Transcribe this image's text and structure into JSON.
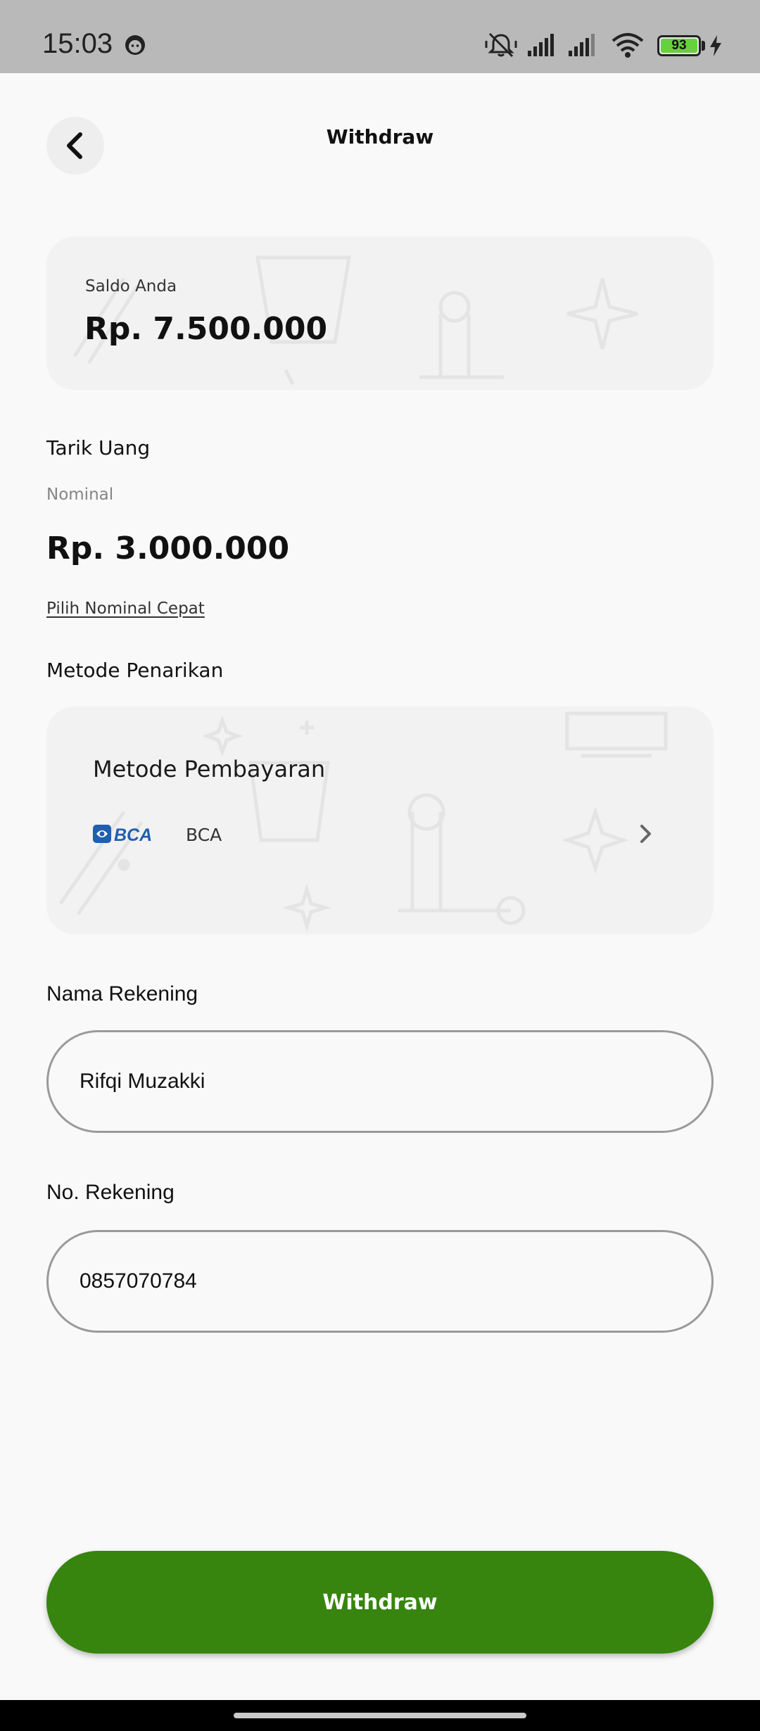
{
  "status_bar": {
    "time": "15:03",
    "battery": "93",
    "icons": [
      "face-notification-icon",
      "mute-icon",
      "signal-icon",
      "signal-icon",
      "wifi-icon",
      "battery-icon",
      "charging-icon"
    ]
  },
  "header": {
    "title": "Withdraw",
    "back_icon": "back-arrow-icon"
  },
  "balance": {
    "label": "Saldo Anda",
    "value": "Rp. 7.500.000"
  },
  "withdraw_amount": {
    "section_title": "Tarik Uang",
    "label": "Nominal",
    "value": "Rp. 3.000.000",
    "quick_link": "Pilih Nominal Cepat"
  },
  "method": {
    "section_title": "Metode Penarikan",
    "card_title": "Metode Pembayaran",
    "bank_logo": "BCA",
    "bank_name": "BCA",
    "chevron_icon": "chevron-right-icon"
  },
  "account_name": {
    "label": "Nama Rekening",
    "value": "Rifqi Muzakki"
  },
  "account_number": {
    "label": "No. Rekening",
    "value": "0857070784"
  },
  "submit": {
    "label": "Withdraw"
  },
  "colors": {
    "primary_button": "#37840f",
    "background": "#f9f9f9",
    "card": "#f2f2f2",
    "status_bar": "#b9b9b9"
  }
}
